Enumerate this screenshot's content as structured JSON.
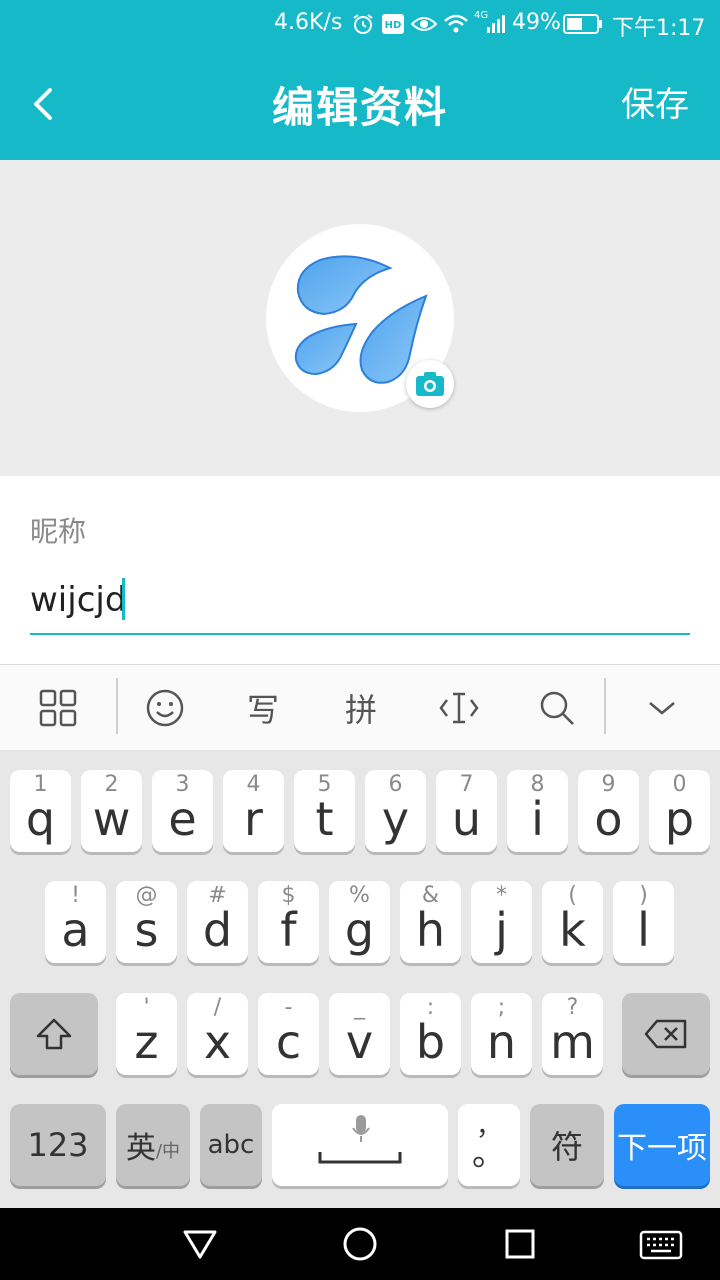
{
  "status_bar": {
    "speed": "4.6K/s",
    "network": "4G",
    "battery": "49%",
    "time": "下午1:17",
    "icons": [
      "alarm-icon",
      "hd-icon",
      "eye-icon",
      "wifi-icon",
      "signal-icon",
      "battery-icon"
    ]
  },
  "header": {
    "title": "编辑资料",
    "save_label": "保存",
    "back_icon": "chevron-left-icon"
  },
  "profile": {
    "avatar_icon": "sweat-droplets-emoji",
    "camera_icon": "camera-icon"
  },
  "form": {
    "nickname_label": "昵称",
    "nickname_value": "wijcjd"
  },
  "keyboard_toolbar": {
    "items": [
      "grid-icon",
      "emoji-icon",
      "handwrite-icon",
      "pinyin-icon",
      "cursor-icon",
      "search-icon",
      "collapse-icon"
    ],
    "handwrite_label": "写",
    "pinyin_label": "拼"
  },
  "keyboard": {
    "row1": [
      {
        "key": "q",
        "hint": "1"
      },
      {
        "key": "w",
        "hint": "2"
      },
      {
        "key": "e",
        "hint": "3"
      },
      {
        "key": "r",
        "hint": "4"
      },
      {
        "key": "t",
        "hint": "5"
      },
      {
        "key": "y",
        "hint": "6"
      },
      {
        "key": "u",
        "hint": "7"
      },
      {
        "key": "i",
        "hint": "8"
      },
      {
        "key": "o",
        "hint": "9"
      },
      {
        "key": "p",
        "hint": "0"
      }
    ],
    "row2": [
      {
        "key": "a",
        "hint": "!"
      },
      {
        "key": "s",
        "hint": "@"
      },
      {
        "key": "d",
        "hint": "#"
      },
      {
        "key": "f",
        "hint": "$"
      },
      {
        "key": "g",
        "hint": "%"
      },
      {
        "key": "h",
        "hint": "&"
      },
      {
        "key": "j",
        "hint": "*"
      },
      {
        "key": "k",
        "hint": "("
      },
      {
        "key": "l",
        "hint": ")"
      }
    ],
    "row3": [
      {
        "key": "z",
        "hint": "'"
      },
      {
        "key": "x",
        "hint": "/"
      },
      {
        "key": "c",
        "hint": "-"
      },
      {
        "key": "v",
        "hint": "_"
      },
      {
        "key": "b",
        "hint": ":"
      },
      {
        "key": "n",
        "hint": ";"
      },
      {
        "key": "m",
        "hint": "?"
      }
    ],
    "num_label": "123",
    "lang_label": "英",
    "lang_sub": "/中",
    "abc_label": "abc",
    "punct_hint": "，",
    "punct_label": "。",
    "symbol_label": "符",
    "enter_label": "下一项"
  },
  "colors": {
    "accent": "#16b9c8",
    "enter_key": "#2a8ff8"
  }
}
